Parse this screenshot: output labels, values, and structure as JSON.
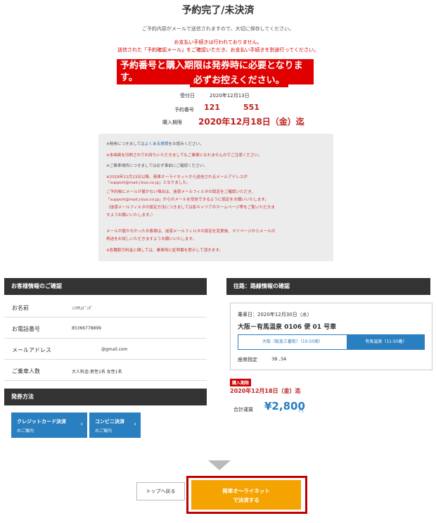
{
  "page": {
    "title": "予約完了/未決済"
  },
  "notices": {
    "mail_note": "ご予約内容がメールで送信されますので、大切に保存してください。",
    "warn_line1": "お支払い手続きは行われておりません。",
    "warn_line2": "送信された「予約確認メール」をご確認いただき、お支払い手続きを別途行ってください。",
    "banner_line1": "予約番号と購入期限は発券時に必要となります。",
    "banner_line2": "必ずお控えください。"
  },
  "reservation": {
    "receipt_label": "受付日",
    "receipt_date": "2020年12月13日",
    "number_label": "予約番号",
    "number_part1": "121",
    "number_part2": "551",
    "deadline_label": "購入期限",
    "deadline": "2020年12月18日（金）迄"
  },
  "notice_box": {
    "l1a": "※発券につきましては",
    "l1_link": "よくある質問",
    "l1b": "をお読みください。",
    "l2": "※本画面を印刷されてお持ちいただきましてもご乗車になれませんのでご注意ください。",
    "l3": "※ご乗車場所につきましては必ず事前にご確認ください。",
    "l4": "※2018年11月13日以降、発車オ～ライネットから送信されるメールアドレスが",
    "l5": "「support@mail.j-bus.co.jp」となりました。",
    "l6": "ご予約後にメールが届かない場合は、迷惑メールフィルタの設定をご確認いただき、",
    "l7": "「support@mail.j-bus.co.jp」からのメールを受信できるように設定をお願いいたします。",
    "l8": "（迷惑メールフィルタの設定方法につきましては各キャリアのホームページ等をご覧いただきま",
    "l9": "すようお願いいたします。）",
    "l10": "メールが届かなかったお客様は、迷惑メールフィルタの設定を変更後、マイページからメールの",
    "l11": "再送をお試しいただきますようお願いいたします。",
    "l12": "※各種割引料金に関しては、乗車時に証明書を提示して頂きます。"
  },
  "customer": {
    "header": "お客様情報のご確認",
    "name_label": "お名前",
    "name_value": "ﾝｼﾔﾁｮﾄﾞﾝﾃﾞ",
    "phone_label": "お電話番号",
    "phone_value": "85366778899",
    "email_label": "メールアドレス",
    "email_value": "@gmail.com",
    "passengers_label": "ご乗車人数",
    "passengers_value": "大人料金:男性1名 女性1名"
  },
  "payment": {
    "header": "発券方法",
    "card_l1": "クレジットカード決済",
    "card_l2": "のご案内",
    "conv_l1": "コンビニ決済",
    "conv_l2": "のご案内",
    "chevron": "›"
  },
  "route": {
    "header": "往路：路線情報の確認",
    "ride_date": "乗車日：2020年12月30日（水）",
    "route_name": "大阪－有馬温泉 0106 便 01 号車",
    "from": "大阪（阪急三番街）（10:50発）",
    "to": "有馬温泉（11:50着）",
    "seat_label": "座席指定",
    "seat_value": "3B ,3A",
    "deadline_badge": "購入期限",
    "deadline": "2020年12月18日（金）迄",
    "total_label": "合計運賃",
    "total_value": "¥2,800",
    "total_unit": "円"
  },
  "actions": {
    "top_button": "トップへ戻る",
    "pay_line1": "発車オ～ライネット",
    "pay_line2": "で決済する"
  },
  "colors": {
    "accent_blue": "#2a7fc0",
    "alert_red": "#e00000",
    "pay_orange": "#f5a300",
    "header_dark": "#333333"
  }
}
